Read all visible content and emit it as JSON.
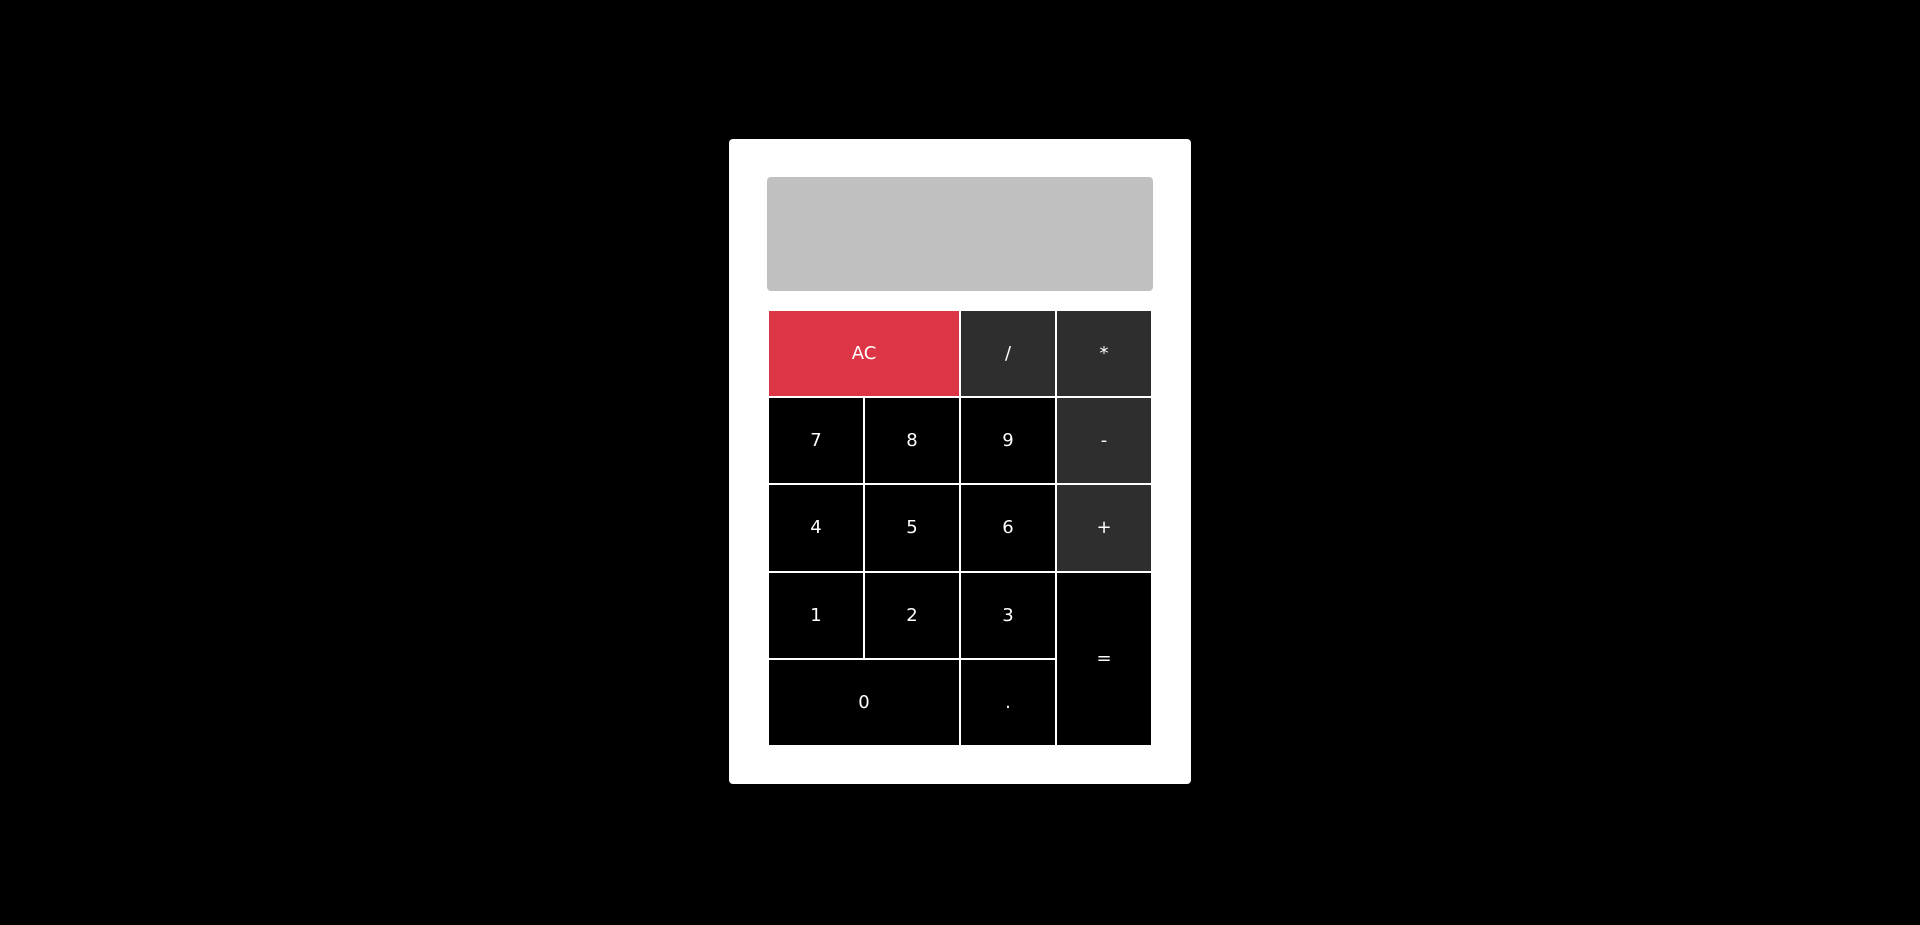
{
  "display": {
    "value": "",
    "background": "#c0c0c0"
  },
  "keys": {
    "clear": "AC",
    "divide": "/",
    "multiply": "*",
    "seven": "7",
    "eight": "8",
    "nine": "9",
    "subtract": "-",
    "four": "4",
    "five": "5",
    "six": "6",
    "add": "+",
    "one": "1",
    "two": "2",
    "three": "3",
    "equals": "=",
    "zero": "0",
    "decimal": "."
  },
  "colors": {
    "page_background": "#000000",
    "calculator_body": "#ffffff",
    "clear_key": "#dc3545",
    "operator_key": "#2e2e2e",
    "digit_key": "#000000"
  }
}
